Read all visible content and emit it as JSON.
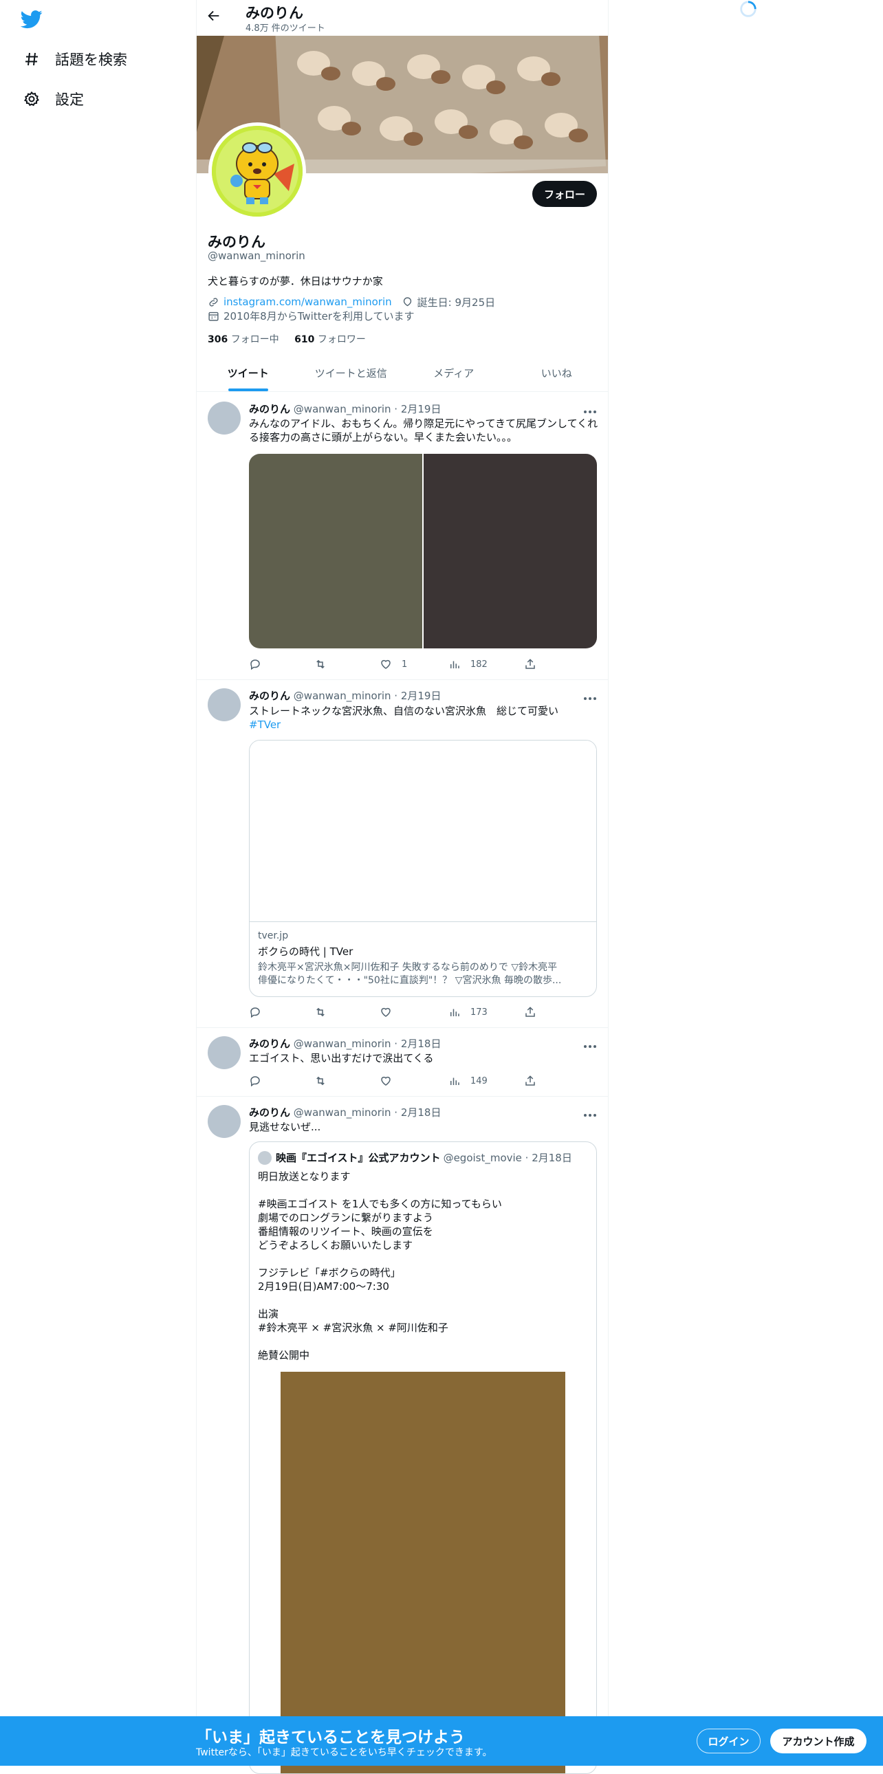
{
  "nav": {
    "items": [
      {
        "label": "話題を検索",
        "icon": "hashtag-icon"
      },
      {
        "label": "設定",
        "icon": "gear-icon"
      }
    ]
  },
  "header": {
    "title": "みのりん",
    "subtitle": "4.8万 件のツイート"
  },
  "profile": {
    "follow_label": "フォロー",
    "name": "みのりん",
    "handle": "@wanwan_minorin",
    "bio": "犬と暮らすのが夢．休日はサウナか家",
    "link": "instagram.com/wanwan_minorin",
    "birthday": "誕生日: 9月25日",
    "joined": "2010年8月からTwitterを利用しています",
    "following_count": "306",
    "following_label": "フォロー中",
    "followers_count": "610",
    "followers_label": "フォロワー"
  },
  "tabs": [
    {
      "label": "ツイート",
      "active": true
    },
    {
      "label": "ツイートと返信",
      "active": false
    },
    {
      "label": "メディア",
      "active": false
    },
    {
      "label": "いいね",
      "active": false
    }
  ],
  "tweets": [
    {
      "name": "みのりん",
      "handle_date": "@wanwan_minorin · 2月19日",
      "text": "みんなのアイドル、おもちくん。帰り際足元にやってきて尻尾ブンしてくれる接客力の高さに頭が上がらない。早くまた会いたい。。。",
      "likes": "1",
      "views": "182",
      "media_colors": [
        "#5f5f4d",
        "#3b3434"
      ]
    },
    {
      "name": "みのりん",
      "handle_date": "@wanwan_minorin · 2月19日",
      "text": "ストレートネックな宮沢氷魚、自信のない宮沢氷魚　総じて可愛い",
      "hashtag": "#TVer",
      "card": {
        "domain": "tver.jp",
        "title": "ボクらの時代 | TVer",
        "desc_line1": "鈴木亮平×宮沢氷魚×阿川佐和子 失敗するなら前のめりで ▽鈴木亮平",
        "desc_line2": "俳優になりたくて・・・\"50社に直談判\"！？ ▽宮沢氷魚 毎晩の散歩..."
      },
      "views": "173"
    },
    {
      "name": "みのりん",
      "handle_date": "@wanwan_minorin · 2月18日",
      "text": "エゴイスト、思い出すだけで涙出てくる",
      "views": "149"
    },
    {
      "name": "みのりん",
      "handle_date": "@wanwan_minorin · 2月18日",
      "text": "見逃せないぜ...",
      "quote": {
        "name": "映画『エゴイスト』公式アカウント",
        "handle_date": "@egoist_movie · 2月18日",
        "lines": [
          "明日放送となります",
          "",
          "#映画エゴイスト を1人でも多くの方に知ってもらい",
          "劇場でのロングランに繋がりますよう",
          "番組情報のリツイート、映画の宣伝を",
          "どうぞよろしくお願いいたします",
          "",
          "フジテレビ「#ボクらの時代」",
          "2月19日(日)AM7:00〜7:30",
          "",
          "出演",
          "#鈴木亮平 × #宮沢氷魚 × #阿川佐和子",
          "",
          "絶賛公開中"
        ],
        "media_color": "#876835"
      }
    }
  ],
  "bottom_bar": {
    "title": "「いま」起きていることを見つけよう",
    "subtitle": "Twitterなら、「いま」起きていることをいち早くチェックできます。",
    "login_label": "ログイン",
    "signup_label": "アカウント作成"
  },
  "colors": {
    "accent": "#1d9bf0",
    "text": "#0f1419",
    "secondary": "#536471",
    "border": "#eff3f4"
  }
}
